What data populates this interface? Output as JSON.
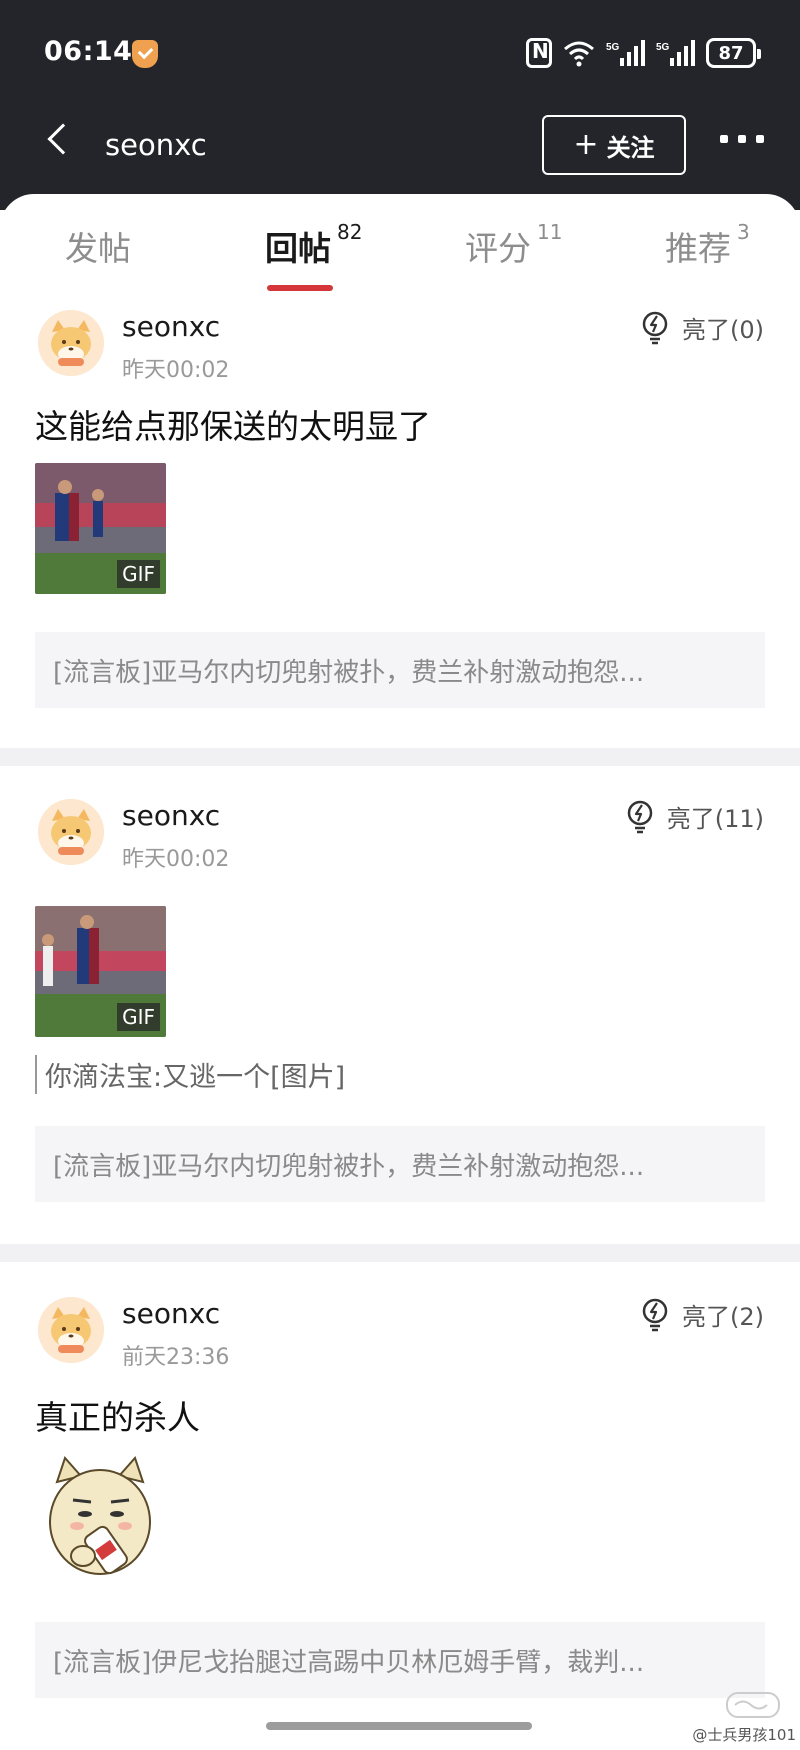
{
  "status_bar": {
    "time": "06:14",
    "battery": "87"
  },
  "header": {
    "title": "seonxc",
    "follow_label": "关注"
  },
  "tabs": [
    {
      "label": "发帖",
      "count": ""
    },
    {
      "label": "回帖",
      "count": "82"
    },
    {
      "label": "评分",
      "count": "11"
    },
    {
      "label": "推荐",
      "count": "3"
    }
  ],
  "posts": [
    {
      "username": "seonxc",
      "time": "昨天00:02",
      "like_label": "亮了(0)",
      "text": "这能给点那保送的太明显了",
      "media_badge": "GIF",
      "quote": "",
      "reference": "[流言板]亚马尔内切兜射被扑，费兰补射激动抱怨..."
    },
    {
      "username": "seonxc",
      "time": "昨天00:02",
      "like_label": "亮了(11)",
      "text": "",
      "media_badge": "GIF",
      "quote": "你滴法宝:又逃一个[图片]",
      "reference": "[流言板]亚马尔内切兜射被扑，费兰补射激动抱怨..."
    },
    {
      "username": "seonxc",
      "time": "前天23:36",
      "like_label": "亮了(2)",
      "text": "真正的杀人",
      "media_badge": "",
      "quote": "",
      "reference": "[流言板]伊尼戈抬腿过高踢中贝林厄姆手臂，裁判..."
    }
  ],
  "watermark": "@士兵男孩101",
  "colors": {
    "header_bg": "#24252a",
    "accent_red": "#d4363a",
    "divider": "#f1f1f3"
  }
}
